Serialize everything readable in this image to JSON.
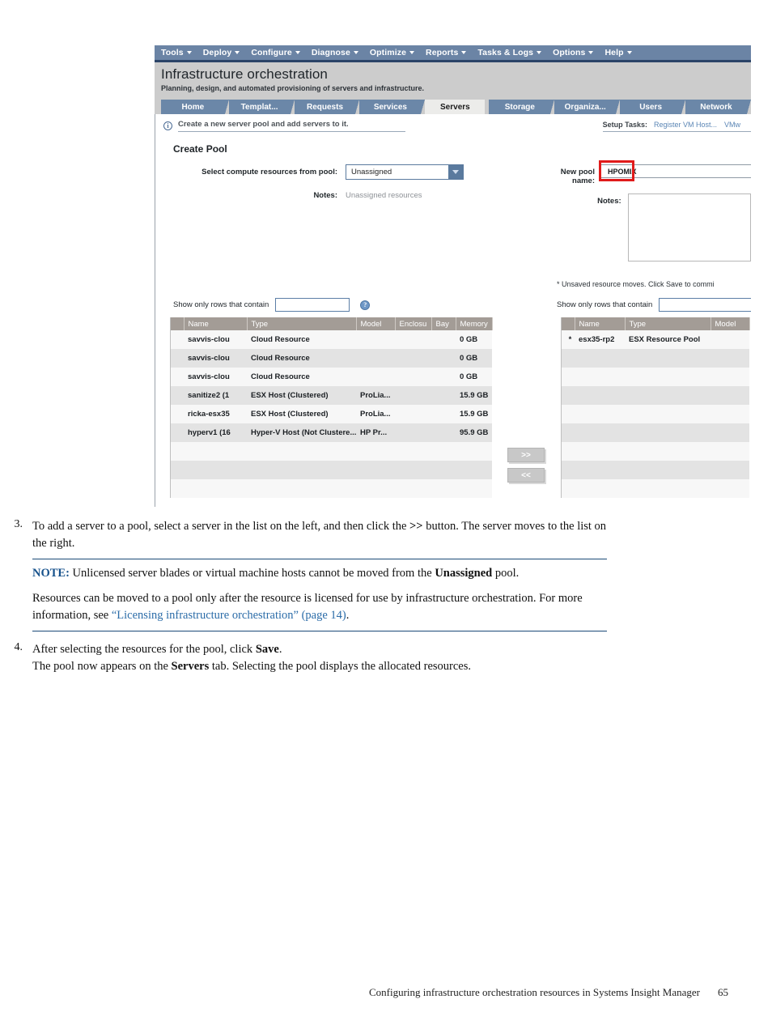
{
  "screenshot": {
    "menubar": [
      {
        "label": "Tools"
      },
      {
        "label": "Deploy"
      },
      {
        "label": "Configure"
      },
      {
        "label": "Diagnose"
      },
      {
        "label": "Optimize"
      },
      {
        "label": "Reports"
      },
      {
        "label": "Tasks & Logs"
      },
      {
        "label": "Options"
      },
      {
        "label": "Help"
      }
    ],
    "app_title": "Infrastructure orchestration",
    "app_subtitle": "Planning, design, and automated provisioning of servers and infrastructure.",
    "tabs": [
      {
        "label": "Home",
        "selected": false
      },
      {
        "label": "Templat...",
        "selected": false
      },
      {
        "label": "Requests",
        "selected": false
      },
      {
        "label": "Services",
        "selected": false
      },
      {
        "label": "Servers",
        "selected": true
      },
      {
        "label": "Storage",
        "selected": false
      },
      {
        "label": "Organiza...",
        "selected": false
      },
      {
        "label": "Users",
        "selected": false
      },
      {
        "label": "Network",
        "selected": false
      }
    ],
    "info_bar": {
      "icon": "info-icon",
      "text": "Create a new server pool and add servers to it.",
      "setup_tasks_label": "Setup Tasks:",
      "setup_links": [
        "Register VM Host...",
        "VMw"
      ]
    },
    "section_title": "Create Pool",
    "left_form": {
      "pool_select_label": "Select compute resources from pool:",
      "pool_select_value": "Unassigned",
      "notes_label": "Notes:",
      "notes_value": "Unassigned resources"
    },
    "right_form": {
      "pool_name_label": "New pool name:",
      "pool_name_value": "HPOMIX",
      "notes_label": "Notes:",
      "notes_value": "",
      "unsaved_message": "* Unsaved resource moves. Click Save to commi",
      "highlight_color": "#e01b1b"
    },
    "left_filter": {
      "label": "Show only rows that contain",
      "value": "",
      "help_icon": "question-mark-icon"
    },
    "right_filter": {
      "label": "Show only rows that contain",
      "value": ""
    },
    "left_table": {
      "columns": [
        "",
        "Name",
        "Type",
        "Model",
        "Enclosu",
        "Bay",
        "Memory"
      ],
      "rows": [
        {
          "sel": "",
          "name": "savvis-clou",
          "type": "Cloud Resource",
          "model": "",
          "enclosure": "",
          "bay": "",
          "memory": "0 GB"
        },
        {
          "sel": "",
          "name": "savvis-clou",
          "type": "Cloud Resource",
          "model": "",
          "enclosure": "",
          "bay": "",
          "memory": "0 GB"
        },
        {
          "sel": "",
          "name": "savvis-clou",
          "type": "Cloud Resource",
          "model": "",
          "enclosure": "",
          "bay": "",
          "memory": "0 GB"
        },
        {
          "sel": "",
          "name": "sanitize2 (1",
          "type": "ESX Host (Clustered)",
          "model": "ProLia...",
          "enclosure": "",
          "bay": "",
          "memory": "15.9 GB"
        },
        {
          "sel": "",
          "name": "ricka-esx35",
          "type": "ESX Host (Clustered)",
          "model": "ProLia...",
          "enclosure": "",
          "bay": "",
          "memory": "15.9 GB"
        },
        {
          "sel": "",
          "name": "hyperv1 (16",
          "type": "Hyper-V Host (Not Clustere...",
          "model": "HP Pr...",
          "enclosure": "",
          "bay": "",
          "memory": "95.9 GB"
        },
        {
          "sel": "",
          "name": "",
          "type": "",
          "model": "",
          "enclosure": "",
          "bay": "",
          "memory": ""
        },
        {
          "sel": "",
          "name": "",
          "type": "",
          "model": "",
          "enclosure": "",
          "bay": "",
          "memory": ""
        },
        {
          "sel": "",
          "name": "",
          "type": "",
          "model": "",
          "enclosure": "",
          "bay": "",
          "memory": ""
        }
      ]
    },
    "move_buttons": {
      "add_label": ">>",
      "remove_label": "<<"
    },
    "right_table": {
      "columns": [
        "",
        "Name",
        "Type",
        "Model"
      ],
      "rows": [
        {
          "sel": "*",
          "name": "esx35-rp2",
          "type": "ESX Resource Pool",
          "model": ""
        },
        {
          "sel": "",
          "name": "",
          "type": "",
          "model": ""
        },
        {
          "sel": "",
          "name": "",
          "type": "",
          "model": ""
        },
        {
          "sel": "",
          "name": "",
          "type": "",
          "model": ""
        },
        {
          "sel": "",
          "name": "",
          "type": "",
          "model": ""
        },
        {
          "sel": "",
          "name": "",
          "type": "",
          "model": ""
        },
        {
          "sel": "",
          "name": "",
          "type": "",
          "model": ""
        },
        {
          "sel": "",
          "name": "",
          "type": "",
          "model": ""
        },
        {
          "sel": "",
          "name": "",
          "type": "",
          "model": ""
        }
      ]
    }
  },
  "document": {
    "step3": {
      "number": "3.",
      "line1_a": "To add a server to a pool, select a server in the list on the left, and then click the ",
      "line1_b": ">>",
      "line1_c": " button. The server moves to the list on the right.",
      "note_label": "NOTE:",
      "note_a": " Unlicensed server blades or virtual machine hosts cannot be moved from the ",
      "note_b": "Unassigned",
      "note_c": " pool.",
      "note_p2_a": "Resources can be moved to a pool only after the resource is licensed for use by infrastructure orchestration. For more information, see ",
      "note_p2_link": "“Licensing infrastructure orchestration” (page 14)",
      "note_p2_end": "."
    },
    "step4": {
      "number": "4.",
      "line1_a": "After selecting the resources for the pool, click ",
      "line1_b": "Save",
      "line1_c": ".",
      "line2_a": "The pool now appears on the ",
      "line2_b": "Servers",
      "line2_c": " tab. Selecting the pool displays the allocated resources."
    },
    "footer_text": "Configuring infrastructure orchestration resources in Systems Insight Manager",
    "footer_page": "65"
  }
}
